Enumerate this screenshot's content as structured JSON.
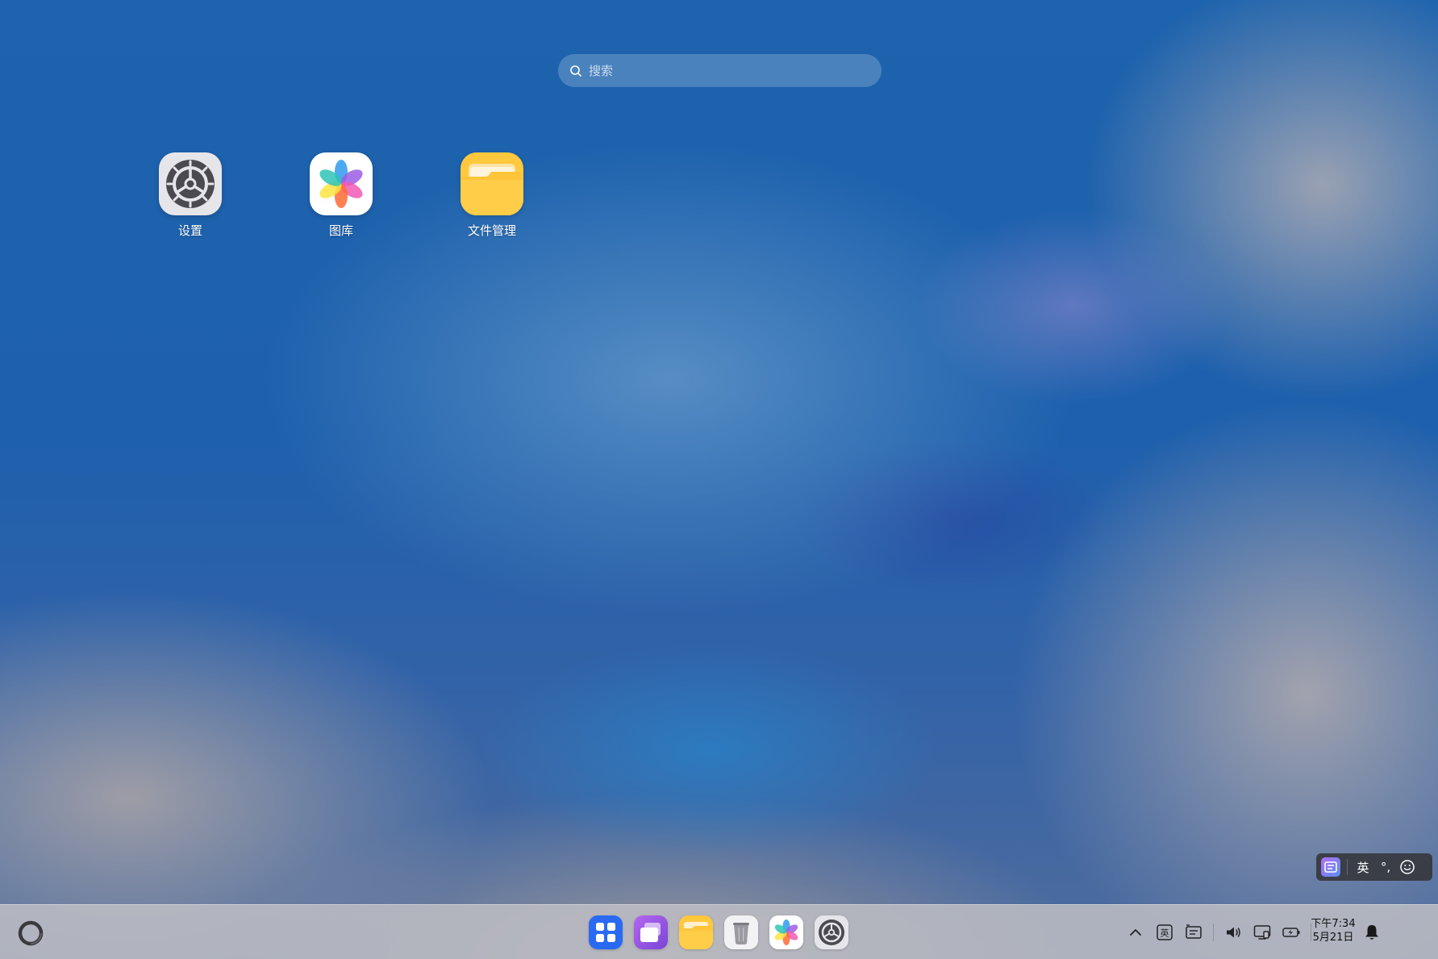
{
  "search": {
    "placeholder": "搜索"
  },
  "desktop_apps": [
    {
      "label": "设置",
      "icon": "settings-gear-icon"
    },
    {
      "label": "图库",
      "icon": "gallery-flower-icon"
    },
    {
      "label": "文件管理",
      "icon": "folder-icon"
    }
  ],
  "ime": {
    "language": "英",
    "punctuation": "°,",
    "emoji_icon": "smiley-icon"
  },
  "taskbar": {
    "start_icon": "ring-icon",
    "dock": [
      "app-grid-icon",
      "multitask-icon",
      "folder-icon",
      "trash-icon",
      "gallery-flower-icon",
      "settings-gear-icon"
    ],
    "tray": [
      "chevron-up-icon",
      "input-method-icon",
      "keyboard-icon",
      "volume-icon",
      "display-icon",
      "battery-icon"
    ],
    "tray_ime_label": "英",
    "clock": {
      "time": "下午7:34",
      "date": "5月21日"
    },
    "bell_icon": "bell-icon"
  },
  "colors": {
    "accent_blue": "#1e63b0",
    "folder_yellow": "#ffc83d",
    "taskbar_bg": "#bebec4"
  }
}
